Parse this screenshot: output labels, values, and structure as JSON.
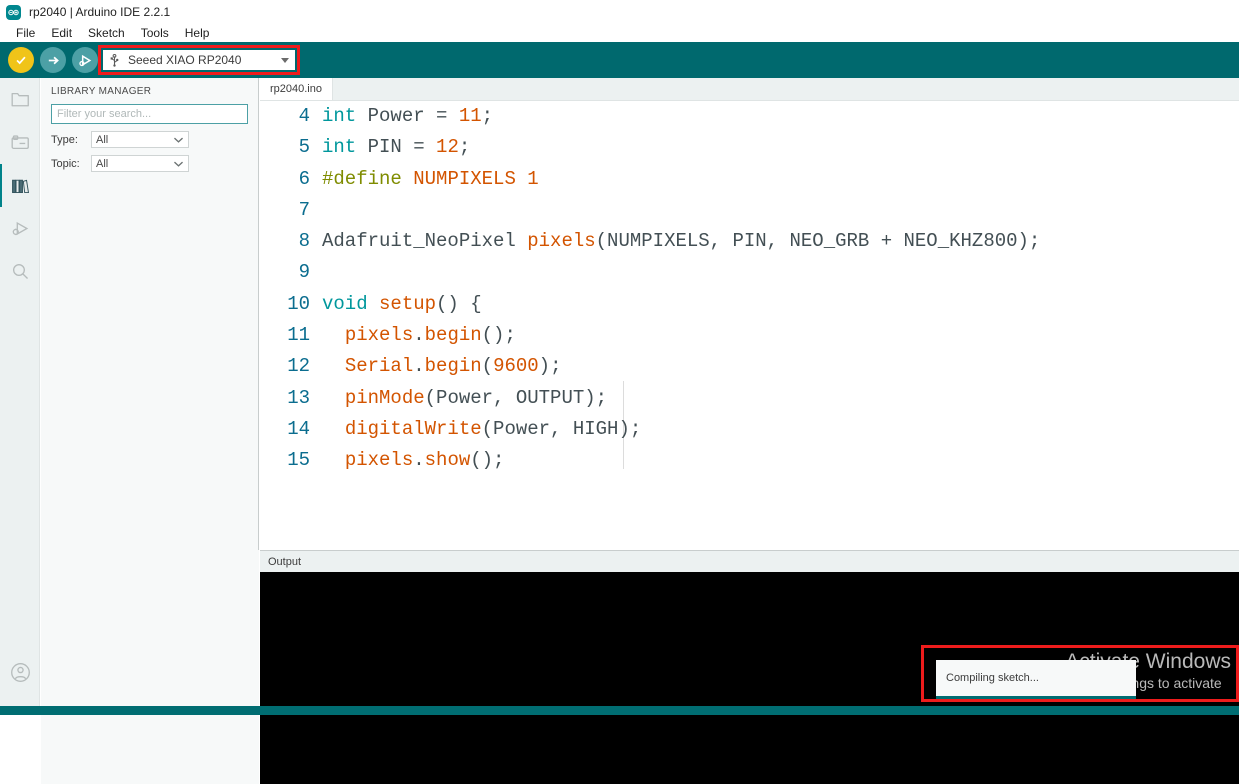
{
  "window": {
    "title": "rp2040 | Arduino IDE 2.2.1",
    "logo_icon": "arduino-logo-icon"
  },
  "menubar": {
    "items": [
      {
        "label": "File"
      },
      {
        "label": "Edit"
      },
      {
        "label": "Sketch"
      },
      {
        "label": "Tools"
      },
      {
        "label": "Help"
      }
    ]
  },
  "toolbar": {
    "verify_icon": "verify-check-icon",
    "upload_icon": "upload-arrow-icon",
    "debug_icon": "debug-icon",
    "board_selector": {
      "usb_icon": "usb-icon",
      "value": "Seeed XIAO RP2040",
      "caret_icon": "chevron-down-icon",
      "highlighted": true,
      "highlight_color": "#ee1c1c"
    }
  },
  "activitybar": {
    "items": [
      {
        "name": "sketchbook",
        "icon": "folder-icon",
        "active": false
      },
      {
        "name": "boards-manager",
        "icon": "boards-manager-icon",
        "active": false
      },
      {
        "name": "library-manager",
        "icon": "library-books-icon",
        "active": true
      },
      {
        "name": "debug",
        "icon": "debug-play-icon",
        "active": false
      },
      {
        "name": "search",
        "icon": "magnifier-icon",
        "active": false
      }
    ],
    "account_icon": "account-circle-icon"
  },
  "sidepanel": {
    "title": "LIBRARY MANAGER",
    "search": {
      "value": "",
      "placeholder": "Filter your search..."
    },
    "filters": [
      {
        "label": "Type:",
        "value": "All",
        "caret_icon": "chevron-down-icon"
      },
      {
        "label": "Topic:",
        "value": "All",
        "caret_icon": "chevron-down-icon"
      }
    ]
  },
  "editor": {
    "tabs": [
      {
        "label": "rp2040.ino",
        "active": true
      }
    ],
    "first_visible_line": 4,
    "lines": [
      {
        "number": "4",
        "tokens": [
          {
            "t": "int",
            "c": "t-kw"
          },
          {
            "t": " Power ",
            "c": "t-plain"
          },
          {
            "t": "=",
            "c": "t-punc"
          },
          {
            "t": " ",
            "c": "t-plain"
          },
          {
            "t": "11",
            "c": "t-num"
          },
          {
            "t": ";",
            "c": "t-punc"
          }
        ]
      },
      {
        "number": "5",
        "tokens": [
          {
            "t": "int",
            "c": "t-kw"
          },
          {
            "t": " PIN ",
            "c": "t-plain"
          },
          {
            "t": "=",
            "c": "t-punc"
          },
          {
            "t": " ",
            "c": "t-plain"
          },
          {
            "t": "12",
            "c": "t-num"
          },
          {
            "t": ";",
            "c": "t-punc"
          }
        ]
      },
      {
        "number": "6",
        "tokens": [
          {
            "t": "#define",
            "c": "t-pre"
          },
          {
            "t": " ",
            "c": "t-plain"
          },
          {
            "t": "NUMPIXELS",
            "c": "t-const"
          },
          {
            "t": " ",
            "c": "t-plain"
          },
          {
            "t": "1",
            "c": "t-num"
          }
        ]
      },
      {
        "number": "7",
        "tokens": []
      },
      {
        "number": "8",
        "tokens": [
          {
            "t": "Adafruit_NeoPixel ",
            "c": "t-plain"
          },
          {
            "t": "pixels",
            "c": "t-fn"
          },
          {
            "t": "(NUMPIXELS, PIN, NEO_GRB + NEO_KHZ800);",
            "c": "t-plain"
          }
        ]
      },
      {
        "number": "9",
        "tokens": []
      },
      {
        "number": "10",
        "tokens": [
          {
            "t": "void",
            "c": "t-kw"
          },
          {
            "t": " ",
            "c": "t-plain"
          },
          {
            "t": "setup",
            "c": "t-fn"
          },
          {
            "t": "() {",
            "c": "t-punc"
          }
        ]
      },
      {
        "number": "11",
        "tokens": [
          {
            "t": "  ",
            "c": "t-plain"
          },
          {
            "t": "pixels",
            "c": "t-fn"
          },
          {
            "t": ".",
            "c": "t-punc"
          },
          {
            "t": "begin",
            "c": "t-fn"
          },
          {
            "t": "();",
            "c": "t-punc"
          }
        ]
      },
      {
        "number": "12",
        "tokens": [
          {
            "t": "  ",
            "c": "t-plain"
          },
          {
            "t": "Serial",
            "c": "t-fn"
          },
          {
            "t": ".",
            "c": "t-punc"
          },
          {
            "t": "begin",
            "c": "t-fn"
          },
          {
            "t": "(",
            "c": "t-punc"
          },
          {
            "t": "9600",
            "c": "t-num"
          },
          {
            "t": ");",
            "c": "t-punc"
          }
        ]
      },
      {
        "number": "13",
        "tokens": [
          {
            "t": "  ",
            "c": "t-plain"
          },
          {
            "t": "pinMode",
            "c": "t-fn"
          },
          {
            "t": "(Power, OUTPUT);",
            "c": "t-plain"
          }
        ]
      },
      {
        "number": "14",
        "tokens": [
          {
            "t": "  ",
            "c": "t-plain"
          },
          {
            "t": "digitalWrite",
            "c": "t-fn"
          },
          {
            "t": "(Power, HIGH);",
            "c": "t-plain"
          }
        ]
      },
      {
        "number": "15",
        "tokens": [
          {
            "t": "  ",
            "c": "t-plain"
          },
          {
            "t": "pixels",
            "c": "t-fn"
          },
          {
            "t": ".",
            "c": "t-punc"
          },
          {
            "t": "show",
            "c": "t-fn"
          },
          {
            "t": "();",
            "c": "t-punc"
          }
        ]
      }
    ]
  },
  "output": {
    "tab_label": "Output",
    "console_text": ""
  },
  "toast": {
    "message": "Compiling sketch...",
    "progress_color": "#006d72",
    "highlighted": true,
    "highlight_color": "#ee1c1c"
  },
  "watermark": {
    "line1": "Activate Windows",
    "line2": "Go to Settings to activate"
  },
  "theme": {
    "toolbar_bg": "#00696e",
    "statusbar_bg": "#006d72",
    "accent": "#00979c",
    "panel_bg": "#f7f9f9",
    "activitybar_bg": "#ecf1f1",
    "console_bg": "#000000",
    "highlight_red": "#ee1c1c"
  }
}
